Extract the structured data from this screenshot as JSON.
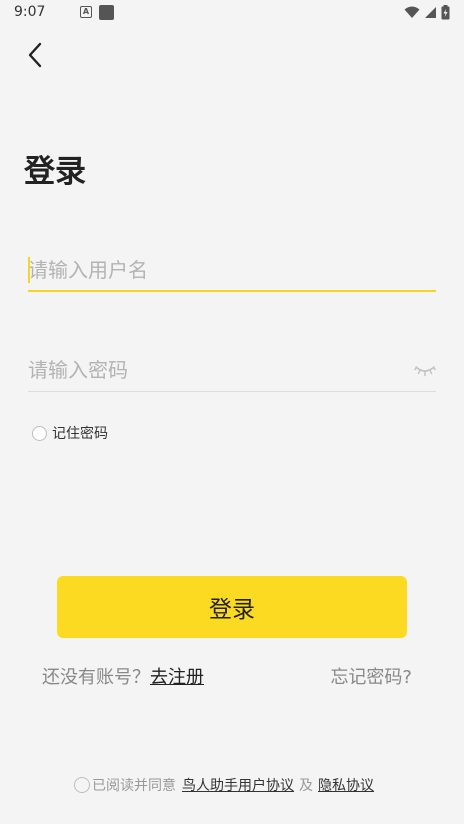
{
  "status_bar": {
    "time": "9:07",
    "icons": [
      "notification-a-icon",
      "notification-square-icon",
      "wifi-icon",
      "cell-signal-icon",
      "battery-icon"
    ]
  },
  "nav": {
    "back_icon": "chevron-left-icon"
  },
  "title": "登录",
  "username": {
    "placeholder": "请输入用户名",
    "value": ""
  },
  "password": {
    "placeholder": "请输入密码",
    "value": "",
    "toggle_icon": "eye-closed-icon"
  },
  "remember": {
    "label": "记住密码",
    "checked": false
  },
  "login_button": "登录",
  "register": {
    "prompt": "还没有账号？",
    "link": "去注册"
  },
  "forgot_password": "忘记密码?",
  "agreement": {
    "prefix": "已阅读并同意",
    "user_agreement": "鸟人助手用户协议",
    "and": "及",
    "privacy_policy": "隐私协议",
    "checked": false
  },
  "colors": {
    "accent": "#fdda22",
    "background": "#f4f4f4"
  }
}
